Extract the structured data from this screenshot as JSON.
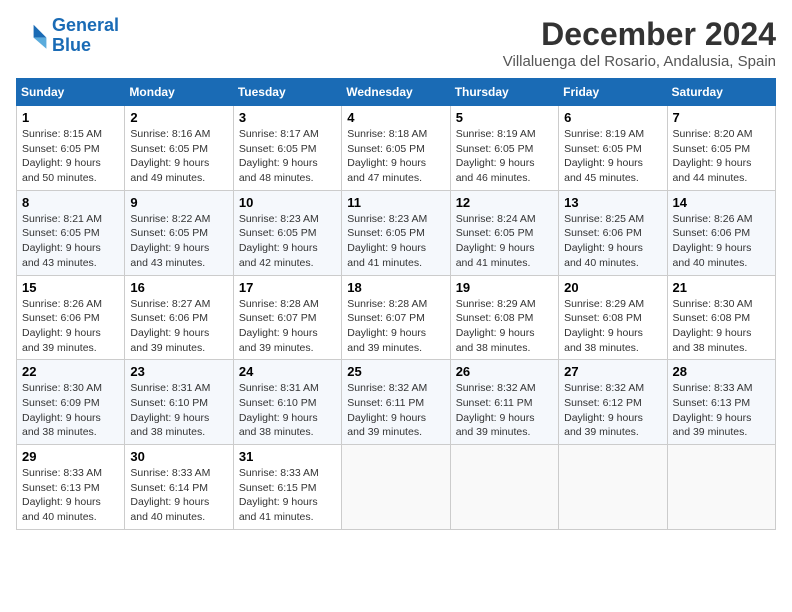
{
  "header": {
    "logo_line1": "General",
    "logo_line2": "Blue",
    "month": "December 2024",
    "location": "Villaluenga del Rosario, Andalusia, Spain"
  },
  "weekdays": [
    "Sunday",
    "Monday",
    "Tuesday",
    "Wednesday",
    "Thursday",
    "Friday",
    "Saturday"
  ],
  "weeks": [
    [
      {
        "day": "1",
        "sunrise": "8:15 AM",
        "sunset": "6:05 PM",
        "daylight": "9 hours and 50 minutes."
      },
      {
        "day": "2",
        "sunrise": "8:16 AM",
        "sunset": "6:05 PM",
        "daylight": "9 hours and 49 minutes."
      },
      {
        "day": "3",
        "sunrise": "8:17 AM",
        "sunset": "6:05 PM",
        "daylight": "9 hours and 48 minutes."
      },
      {
        "day": "4",
        "sunrise": "8:18 AM",
        "sunset": "6:05 PM",
        "daylight": "9 hours and 47 minutes."
      },
      {
        "day": "5",
        "sunrise": "8:19 AM",
        "sunset": "6:05 PM",
        "daylight": "9 hours and 46 minutes."
      },
      {
        "day": "6",
        "sunrise": "8:19 AM",
        "sunset": "6:05 PM",
        "daylight": "9 hours and 45 minutes."
      },
      {
        "day": "7",
        "sunrise": "8:20 AM",
        "sunset": "6:05 PM",
        "daylight": "9 hours and 44 minutes."
      }
    ],
    [
      {
        "day": "8",
        "sunrise": "8:21 AM",
        "sunset": "6:05 PM",
        "daylight": "9 hours and 43 minutes."
      },
      {
        "day": "9",
        "sunrise": "8:22 AM",
        "sunset": "6:05 PM",
        "daylight": "9 hours and 43 minutes."
      },
      {
        "day": "10",
        "sunrise": "8:23 AM",
        "sunset": "6:05 PM",
        "daylight": "9 hours and 42 minutes."
      },
      {
        "day": "11",
        "sunrise": "8:23 AM",
        "sunset": "6:05 PM",
        "daylight": "9 hours and 41 minutes."
      },
      {
        "day": "12",
        "sunrise": "8:24 AM",
        "sunset": "6:05 PM",
        "daylight": "9 hours and 41 minutes."
      },
      {
        "day": "13",
        "sunrise": "8:25 AM",
        "sunset": "6:06 PM",
        "daylight": "9 hours and 40 minutes."
      },
      {
        "day": "14",
        "sunrise": "8:26 AM",
        "sunset": "6:06 PM",
        "daylight": "9 hours and 40 minutes."
      }
    ],
    [
      {
        "day": "15",
        "sunrise": "8:26 AM",
        "sunset": "6:06 PM",
        "daylight": "9 hours and 39 minutes."
      },
      {
        "day": "16",
        "sunrise": "8:27 AM",
        "sunset": "6:06 PM",
        "daylight": "9 hours and 39 minutes."
      },
      {
        "day": "17",
        "sunrise": "8:28 AM",
        "sunset": "6:07 PM",
        "daylight": "9 hours and 39 minutes."
      },
      {
        "day": "18",
        "sunrise": "8:28 AM",
        "sunset": "6:07 PM",
        "daylight": "9 hours and 39 minutes."
      },
      {
        "day": "19",
        "sunrise": "8:29 AM",
        "sunset": "6:08 PM",
        "daylight": "9 hours and 38 minutes."
      },
      {
        "day": "20",
        "sunrise": "8:29 AM",
        "sunset": "6:08 PM",
        "daylight": "9 hours and 38 minutes."
      },
      {
        "day": "21",
        "sunrise": "8:30 AM",
        "sunset": "6:08 PM",
        "daylight": "9 hours and 38 minutes."
      }
    ],
    [
      {
        "day": "22",
        "sunrise": "8:30 AM",
        "sunset": "6:09 PM",
        "daylight": "9 hours and 38 minutes."
      },
      {
        "day": "23",
        "sunrise": "8:31 AM",
        "sunset": "6:10 PM",
        "daylight": "9 hours and 38 minutes."
      },
      {
        "day": "24",
        "sunrise": "8:31 AM",
        "sunset": "6:10 PM",
        "daylight": "9 hours and 38 minutes."
      },
      {
        "day": "25",
        "sunrise": "8:32 AM",
        "sunset": "6:11 PM",
        "daylight": "9 hours and 39 minutes."
      },
      {
        "day": "26",
        "sunrise": "8:32 AM",
        "sunset": "6:11 PM",
        "daylight": "9 hours and 39 minutes."
      },
      {
        "day": "27",
        "sunrise": "8:32 AM",
        "sunset": "6:12 PM",
        "daylight": "9 hours and 39 minutes."
      },
      {
        "day": "28",
        "sunrise": "8:33 AM",
        "sunset": "6:13 PM",
        "daylight": "9 hours and 39 minutes."
      }
    ],
    [
      {
        "day": "29",
        "sunrise": "8:33 AM",
        "sunset": "6:13 PM",
        "daylight": "9 hours and 40 minutes."
      },
      {
        "day": "30",
        "sunrise": "8:33 AM",
        "sunset": "6:14 PM",
        "daylight": "9 hours and 40 minutes."
      },
      {
        "day": "31",
        "sunrise": "8:33 AM",
        "sunset": "6:15 PM",
        "daylight": "9 hours and 41 minutes."
      },
      null,
      null,
      null,
      null
    ]
  ]
}
